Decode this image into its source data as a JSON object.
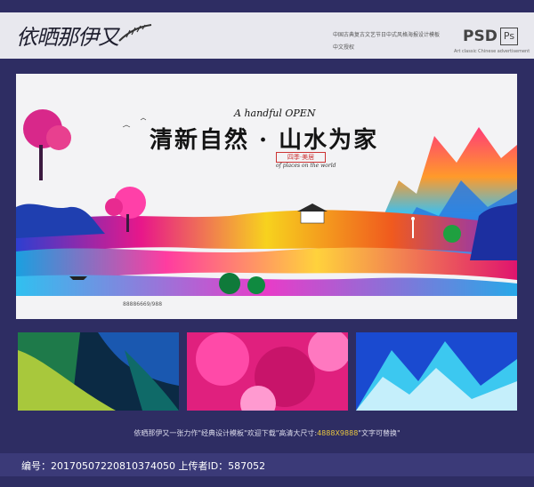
{
  "header": {
    "signature": "依晒那伊又",
    "cn_line": "中国古典复古文艺节日中式风格海报设计模板",
    "sub_line": "中文授权",
    "psd_label": "PSD",
    "ps_label": "Ps",
    "eng_line": "Art classic Chinese advertisement"
  },
  "poster": {
    "headline_en": "A handful OPEN",
    "headline_cn": "清新自然 · 山水为家",
    "stamp_text": "四季·美居",
    "subhead_en": "of places on the world",
    "hotline": "88886669/988",
    "colors": {
      "accent": "#e8178a",
      "sky": "#f3f3f5",
      "water": "#2ab0e8"
    }
  },
  "thumbnails": [
    {
      "name": "green-texture"
    },
    {
      "name": "pink-blossom"
    },
    {
      "name": "blue-mountain"
    }
  ],
  "footer": {
    "note_pre": "依晒那伊又一张力作\"经典设计模板\"欢迎下载\"高清大尺寸:",
    "note_size": "4888X9888",
    "note_post": "\"文字可替换\"",
    "id_line": "编号：20170507220810374050 上传者ID：587052"
  },
  "colors": {
    "background": "#2e2d63",
    "footer_bar": "#3b3a78",
    "highlight": "#e8c640"
  }
}
